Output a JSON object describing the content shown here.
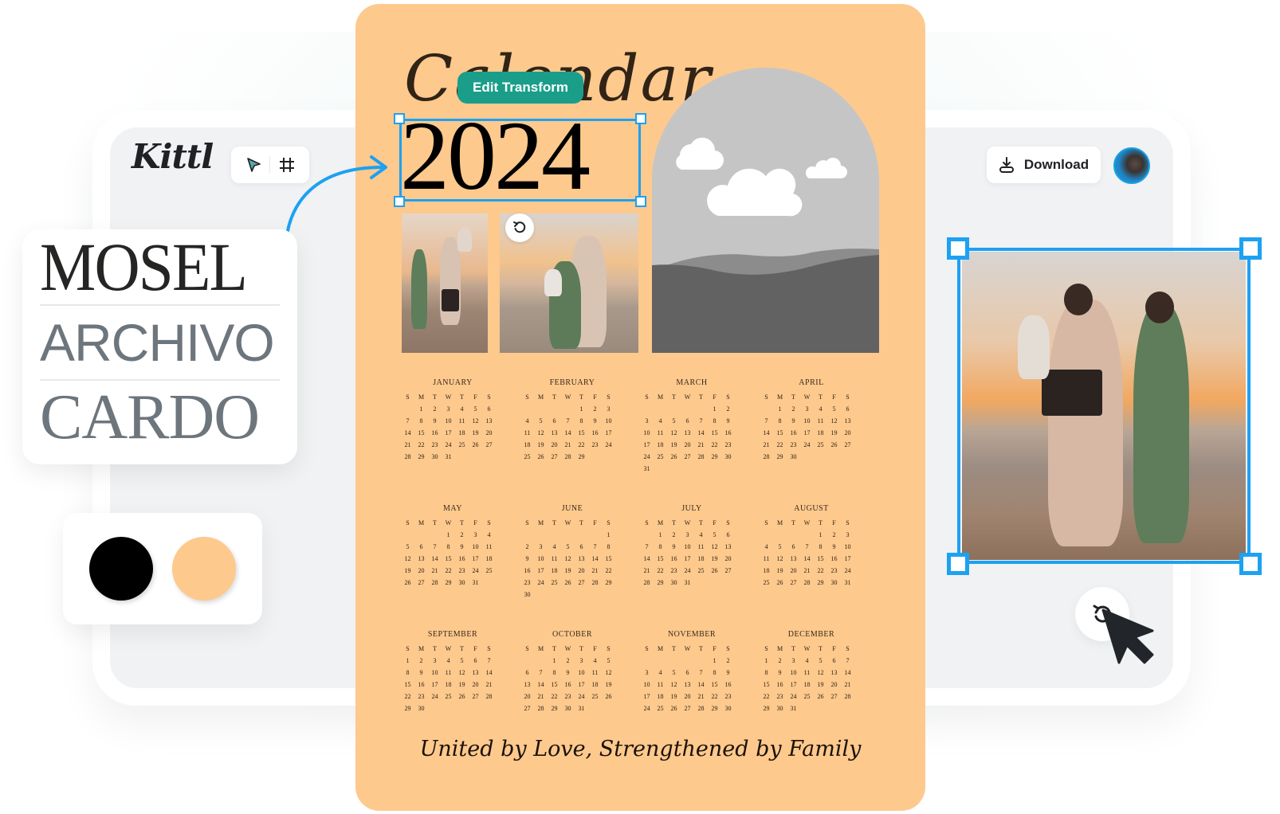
{
  "app": {
    "logo": "Kittl",
    "tools": [
      {
        "name": "select-tool",
        "icon": "cursor-arrow-icon"
      },
      {
        "name": "frame-tool",
        "icon": "frame-grid-icon"
      }
    ],
    "download_label": "Download",
    "avatar_icon": "user-avatar"
  },
  "font_picker": {
    "fonts": [
      "MOSEL",
      "ARCHIVO",
      "CARDO"
    ]
  },
  "palette": {
    "colors": [
      "#000000",
      "#fdc98d"
    ]
  },
  "poster": {
    "title": "Calendar",
    "year": "2024",
    "edit_transform_label": "Edit Transform",
    "tagline": "United by Love, Strengthened by Family",
    "background_color": "#fdc98d",
    "weekdays": [
      "S",
      "M",
      "T",
      "W",
      "T",
      "F",
      "S"
    ],
    "months": [
      {
        "name": "JANUARY",
        "start": 1,
        "days": 31
      },
      {
        "name": "FEBRUARY",
        "start": 4,
        "days": 29
      },
      {
        "name": "MARCH",
        "start": 5,
        "days": 31
      },
      {
        "name": "APRIL",
        "start": 1,
        "days": 30
      },
      {
        "name": "MAY",
        "start": 3,
        "days": 31
      },
      {
        "name": "JUNE",
        "start": 6,
        "days": 30
      },
      {
        "name": "JULY",
        "start": 1,
        "days": 31
      },
      {
        "name": "AUGUST",
        "start": 4,
        "days": 31
      },
      {
        "name": "SEPTEMBER",
        "start": 0,
        "days": 30
      },
      {
        "name": "OCTOBER",
        "start": 2,
        "days": 31
      },
      {
        "name": "NOVEMBER",
        "start": 5,
        "days": 30
      },
      {
        "name": "DECEMBER",
        "start": 0,
        "days": 31
      }
    ]
  },
  "colors": {
    "selection": "#1da1f2",
    "edit_button": "#1a9e8a"
  }
}
